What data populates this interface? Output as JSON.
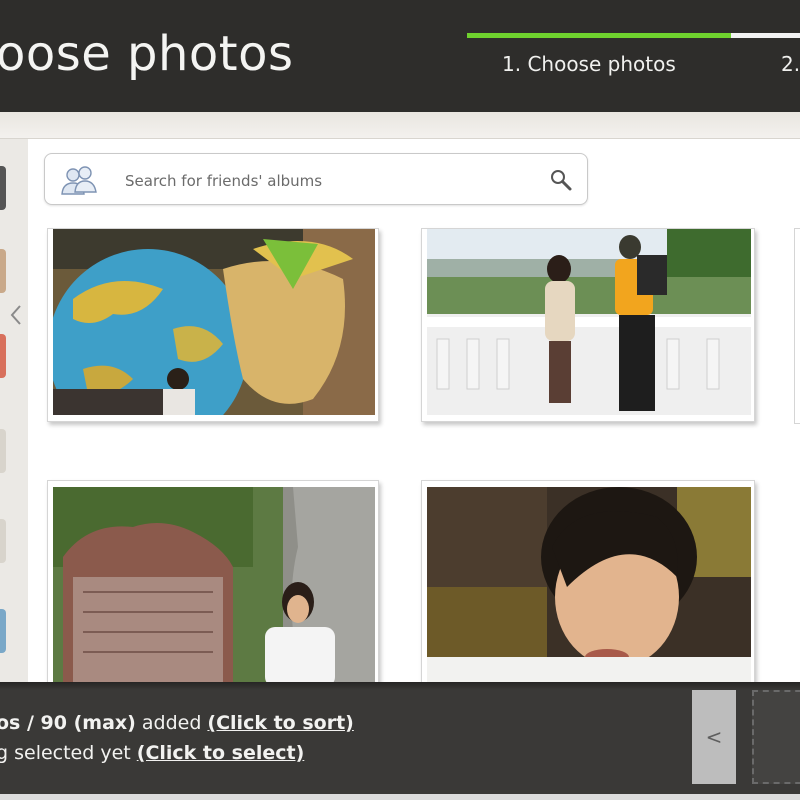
{
  "header": {
    "title": "oose photos",
    "steps": [
      "1. Choose photos",
      "2."
    ]
  },
  "search": {
    "placeholder": "Search for friends' albums"
  },
  "photos": [
    {
      "alt": "statue-with-globe"
    },
    {
      "alt": "couple-on-balcony"
    },
    {
      "alt": "woman-by-stone-plaque"
    },
    {
      "alt": "woman-smiling"
    }
  ],
  "status": {
    "line1_count": "os / 90 (max)",
    "line1_suffix": " added ",
    "line1_link": "(Click to sort)",
    "line2_prefix": "g selected yet ",
    "line2_link": "(Click to select)"
  },
  "tray": {
    "prev_label": "<"
  },
  "colors": {
    "progress_done": "#6fd12e",
    "progress_todo": "#f2f2f2",
    "header_bg": "#2e2d2b",
    "bottom_bg": "#3a3937"
  },
  "icons": [
    "friends-icon",
    "search-icon",
    "chevron-left-icon"
  ]
}
